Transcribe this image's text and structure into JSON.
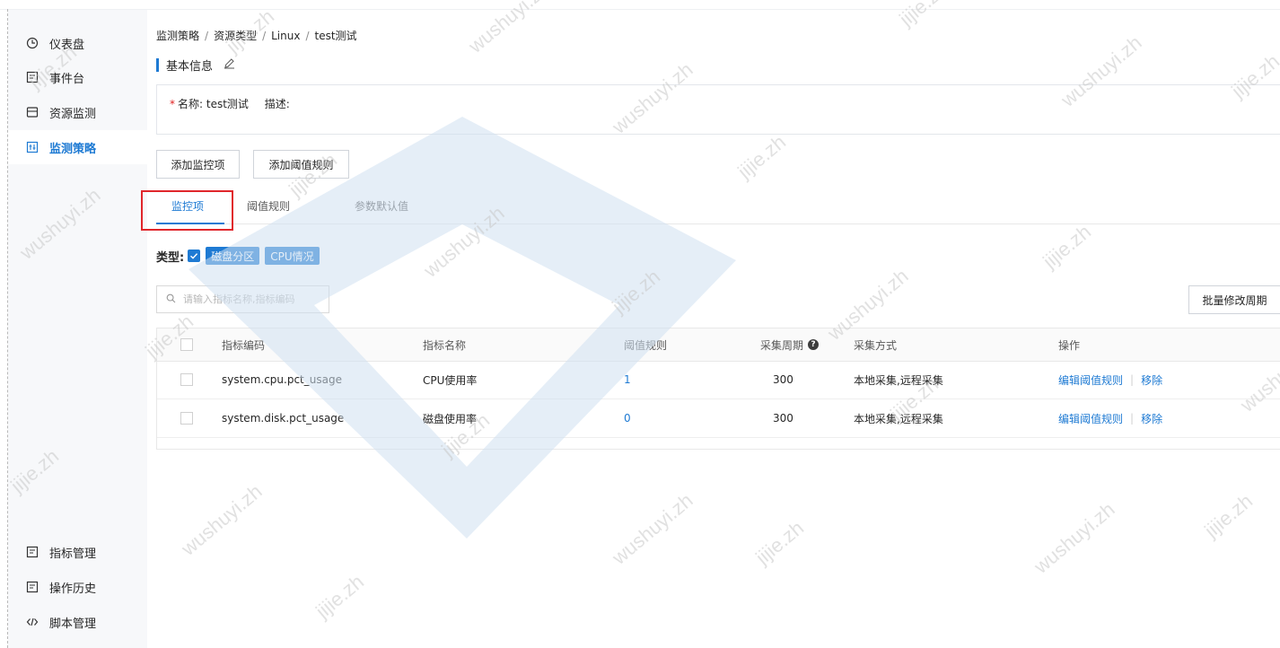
{
  "sidebar": {
    "top_items": [
      {
        "label": "仪表盘",
        "icon": "dashboard-icon"
      },
      {
        "label": "事件台",
        "icon": "event-icon"
      },
      {
        "label": "资源监测",
        "icon": "monitor-icon"
      },
      {
        "label": "监测策略",
        "icon": "policy-icon",
        "active": true
      }
    ],
    "bottom_items": [
      {
        "label": "指标管理",
        "icon": "metric-icon"
      },
      {
        "label": "操作历史",
        "icon": "history-icon"
      },
      {
        "label": "脚本管理",
        "icon": "code-icon"
      }
    ]
  },
  "breadcrumb": [
    "监测策略",
    "资源类型",
    "Linux",
    "test测试"
  ],
  "breadcrumb_sep": "/",
  "basic_info": {
    "title": "基本信息",
    "name_label": "名称:",
    "name_value": "test测试",
    "desc_label": "描述:",
    "required_mark": "*"
  },
  "actions": {
    "add_monitor_item": "添加监控项",
    "add_threshold_rule": "添加阈值规则",
    "batch_modify_period": "批量修改周期"
  },
  "tabs": [
    {
      "label": "监控项",
      "active": true
    },
    {
      "label": "阈值规则"
    },
    {
      "label": "参数默认值"
    }
  ],
  "type_filter": {
    "label": "类型:",
    "tags": [
      "磁盘分区",
      "CPU情况"
    ]
  },
  "search": {
    "placeholder": "请输入指标名称,指标编码"
  },
  "table": {
    "columns": [
      "指标编码",
      "指标名称",
      "阈值规则",
      "采集周期",
      "采集方式",
      "操作"
    ],
    "rows": [
      {
        "code": "system.cpu.pct_usage",
        "name": "CPU使用率",
        "rules": "1",
        "period": "300",
        "method": "本地采集,远程采集",
        "op_edit": "编辑阈值规则",
        "op_remove": "移除"
      },
      {
        "code": "system.disk.pct_usage",
        "name": "磁盘使用率",
        "rules": "0",
        "period": "300",
        "method": "本地采集,远程采集",
        "op_edit": "编辑阈值规则",
        "op_remove": "移除"
      }
    ]
  },
  "watermarks": [
    "jijie.zh",
    "wushuyi.zh"
  ],
  "colors": {
    "accent": "#1e7ad3",
    "sidebar_bg": "#f7f8fa",
    "highlight_box": "#e0262b",
    "watermark_logo": "#d4e4f2"
  }
}
